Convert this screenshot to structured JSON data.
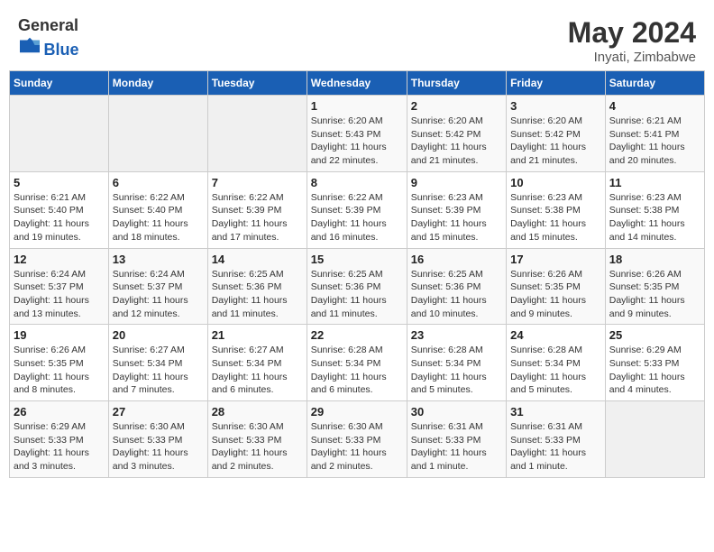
{
  "header": {
    "logo_general": "General",
    "logo_blue": "Blue",
    "month_year": "May 2024",
    "location": "Inyati, Zimbabwe"
  },
  "days_of_week": [
    "Sunday",
    "Monday",
    "Tuesday",
    "Wednesday",
    "Thursday",
    "Friday",
    "Saturday"
  ],
  "weeks": [
    [
      {
        "day": "",
        "sunrise": "",
        "sunset": "",
        "daylight": ""
      },
      {
        "day": "",
        "sunrise": "",
        "sunset": "",
        "daylight": ""
      },
      {
        "day": "",
        "sunrise": "",
        "sunset": "",
        "daylight": ""
      },
      {
        "day": "1",
        "sunrise": "Sunrise: 6:20 AM",
        "sunset": "Sunset: 5:43 PM",
        "daylight": "Daylight: 11 hours and 22 minutes."
      },
      {
        "day": "2",
        "sunrise": "Sunrise: 6:20 AM",
        "sunset": "Sunset: 5:42 PM",
        "daylight": "Daylight: 11 hours and 21 minutes."
      },
      {
        "day": "3",
        "sunrise": "Sunrise: 6:20 AM",
        "sunset": "Sunset: 5:42 PM",
        "daylight": "Daylight: 11 hours and 21 minutes."
      },
      {
        "day": "4",
        "sunrise": "Sunrise: 6:21 AM",
        "sunset": "Sunset: 5:41 PM",
        "daylight": "Daylight: 11 hours and 20 minutes."
      }
    ],
    [
      {
        "day": "5",
        "sunrise": "Sunrise: 6:21 AM",
        "sunset": "Sunset: 5:40 PM",
        "daylight": "Daylight: 11 hours and 19 minutes."
      },
      {
        "day": "6",
        "sunrise": "Sunrise: 6:22 AM",
        "sunset": "Sunset: 5:40 PM",
        "daylight": "Daylight: 11 hours and 18 minutes."
      },
      {
        "day": "7",
        "sunrise": "Sunrise: 6:22 AM",
        "sunset": "Sunset: 5:39 PM",
        "daylight": "Daylight: 11 hours and 17 minutes."
      },
      {
        "day": "8",
        "sunrise": "Sunrise: 6:22 AM",
        "sunset": "Sunset: 5:39 PM",
        "daylight": "Daylight: 11 hours and 16 minutes."
      },
      {
        "day": "9",
        "sunrise": "Sunrise: 6:23 AM",
        "sunset": "Sunset: 5:39 PM",
        "daylight": "Daylight: 11 hours and 15 minutes."
      },
      {
        "day": "10",
        "sunrise": "Sunrise: 6:23 AM",
        "sunset": "Sunset: 5:38 PM",
        "daylight": "Daylight: 11 hours and 15 minutes."
      },
      {
        "day": "11",
        "sunrise": "Sunrise: 6:23 AM",
        "sunset": "Sunset: 5:38 PM",
        "daylight": "Daylight: 11 hours and 14 minutes."
      }
    ],
    [
      {
        "day": "12",
        "sunrise": "Sunrise: 6:24 AM",
        "sunset": "Sunset: 5:37 PM",
        "daylight": "Daylight: 11 hours and 13 minutes."
      },
      {
        "day": "13",
        "sunrise": "Sunrise: 6:24 AM",
        "sunset": "Sunset: 5:37 PM",
        "daylight": "Daylight: 11 hours and 12 minutes."
      },
      {
        "day": "14",
        "sunrise": "Sunrise: 6:25 AM",
        "sunset": "Sunset: 5:36 PM",
        "daylight": "Daylight: 11 hours and 11 minutes."
      },
      {
        "day": "15",
        "sunrise": "Sunrise: 6:25 AM",
        "sunset": "Sunset: 5:36 PM",
        "daylight": "Daylight: 11 hours and 11 minutes."
      },
      {
        "day": "16",
        "sunrise": "Sunrise: 6:25 AM",
        "sunset": "Sunset: 5:36 PM",
        "daylight": "Daylight: 11 hours and 10 minutes."
      },
      {
        "day": "17",
        "sunrise": "Sunrise: 6:26 AM",
        "sunset": "Sunset: 5:35 PM",
        "daylight": "Daylight: 11 hours and 9 minutes."
      },
      {
        "day": "18",
        "sunrise": "Sunrise: 6:26 AM",
        "sunset": "Sunset: 5:35 PM",
        "daylight": "Daylight: 11 hours and 9 minutes."
      }
    ],
    [
      {
        "day": "19",
        "sunrise": "Sunrise: 6:26 AM",
        "sunset": "Sunset: 5:35 PM",
        "daylight": "Daylight: 11 hours and 8 minutes."
      },
      {
        "day": "20",
        "sunrise": "Sunrise: 6:27 AM",
        "sunset": "Sunset: 5:34 PM",
        "daylight": "Daylight: 11 hours and 7 minutes."
      },
      {
        "day": "21",
        "sunrise": "Sunrise: 6:27 AM",
        "sunset": "Sunset: 5:34 PM",
        "daylight": "Daylight: 11 hours and 6 minutes."
      },
      {
        "day": "22",
        "sunrise": "Sunrise: 6:28 AM",
        "sunset": "Sunset: 5:34 PM",
        "daylight": "Daylight: 11 hours and 6 minutes."
      },
      {
        "day": "23",
        "sunrise": "Sunrise: 6:28 AM",
        "sunset": "Sunset: 5:34 PM",
        "daylight": "Daylight: 11 hours and 5 minutes."
      },
      {
        "day": "24",
        "sunrise": "Sunrise: 6:28 AM",
        "sunset": "Sunset: 5:34 PM",
        "daylight": "Daylight: 11 hours and 5 minutes."
      },
      {
        "day": "25",
        "sunrise": "Sunrise: 6:29 AM",
        "sunset": "Sunset: 5:33 PM",
        "daylight": "Daylight: 11 hours and 4 minutes."
      }
    ],
    [
      {
        "day": "26",
        "sunrise": "Sunrise: 6:29 AM",
        "sunset": "Sunset: 5:33 PM",
        "daylight": "Daylight: 11 hours and 3 minutes."
      },
      {
        "day": "27",
        "sunrise": "Sunrise: 6:30 AM",
        "sunset": "Sunset: 5:33 PM",
        "daylight": "Daylight: 11 hours and 3 minutes."
      },
      {
        "day": "28",
        "sunrise": "Sunrise: 6:30 AM",
        "sunset": "Sunset: 5:33 PM",
        "daylight": "Daylight: 11 hours and 2 minutes."
      },
      {
        "day": "29",
        "sunrise": "Sunrise: 6:30 AM",
        "sunset": "Sunset: 5:33 PM",
        "daylight": "Daylight: 11 hours and 2 minutes."
      },
      {
        "day": "30",
        "sunrise": "Sunrise: 6:31 AM",
        "sunset": "Sunset: 5:33 PM",
        "daylight": "Daylight: 11 hours and 1 minute."
      },
      {
        "day": "31",
        "sunrise": "Sunrise: 6:31 AM",
        "sunset": "Sunset: 5:33 PM",
        "daylight": "Daylight: 11 hours and 1 minute."
      },
      {
        "day": "",
        "sunrise": "",
        "sunset": "",
        "daylight": ""
      }
    ]
  ]
}
